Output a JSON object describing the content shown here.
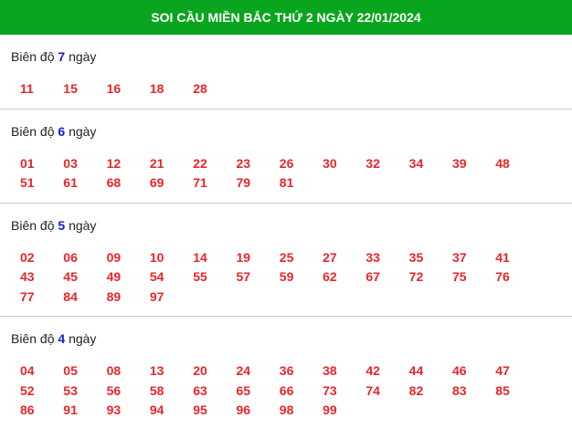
{
  "header": {
    "title": "SOI CẦU MIỀN BẮC THỨ 2 NGÀY 22/01/2024"
  },
  "label_prefix": "Biên độ",
  "label_suffix": "ngày",
  "sections": [
    {
      "days": "7",
      "numbers": [
        "11",
        "15",
        "16",
        "18",
        "28"
      ]
    },
    {
      "days": "6",
      "numbers": [
        "01",
        "03",
        "12",
        "21",
        "22",
        "23",
        "26",
        "30",
        "32",
        "34",
        "39",
        "48",
        "51",
        "61",
        "68",
        "69",
        "71",
        "79",
        "81"
      ]
    },
    {
      "days": "5",
      "numbers": [
        "02",
        "06",
        "09",
        "10",
        "14",
        "19",
        "25",
        "27",
        "33",
        "35",
        "37",
        "41",
        "43",
        "45",
        "49",
        "54",
        "55",
        "57",
        "59",
        "62",
        "67",
        "72",
        "75",
        "76",
        "77",
        "84",
        "89",
        "97"
      ]
    },
    {
      "days": "4",
      "numbers": [
        "04",
        "05",
        "08",
        "13",
        "20",
        "24",
        "36",
        "38",
        "42",
        "44",
        "46",
        "47",
        "52",
        "53",
        "56",
        "58",
        "63",
        "65",
        "66",
        "73",
        "74",
        "82",
        "83",
        "85",
        "86",
        "91",
        "93",
        "94",
        "95",
        "96",
        "98",
        "99"
      ]
    }
  ]
}
